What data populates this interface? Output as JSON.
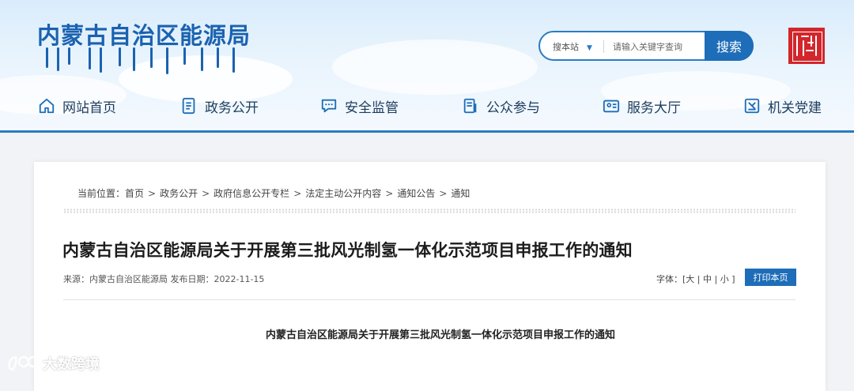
{
  "header": {
    "site_title": "内蒙古自治区能源局",
    "search": {
      "scope_label": "搜本站",
      "placeholder": "请输入关键字查询",
      "button_label": "搜索"
    },
    "seal_glyphs": [
      "内蒙古",
      "ᠥᠪᠥᠷ ᠮᠣᠩᠭᠣᠯ"
    ]
  },
  "nav": {
    "items": [
      {
        "label": "网站首页",
        "icon": "home-icon"
      },
      {
        "label": "政务公开",
        "icon": "document-list-icon"
      },
      {
        "label": "安全监管",
        "icon": "chat-bubble-icon"
      },
      {
        "label": "公众参与",
        "icon": "clipboard-icon"
      },
      {
        "label": "服务大厅",
        "icon": "id-card-icon"
      },
      {
        "label": "机关党建",
        "icon": "party-badge-icon"
      }
    ]
  },
  "breadcrumb": {
    "prefix": "当前位置：",
    "separator": ">",
    "items": [
      "首页",
      "政务公开",
      "政府信息公开专栏",
      "法定主动公开内容",
      "通知公告",
      "通知"
    ]
  },
  "article": {
    "title": "内蒙古自治区能源局关于开展第三批风光制氢一体化示范项目申报工作的通知",
    "meta": "来源：内蒙古自治区能源局 发布日期：2022-11-15",
    "font_size_label": "字体：[",
    "font_sizes": [
      "大",
      "中",
      "小"
    ],
    "font_size_close": "]",
    "print_label": "打印本页",
    "body_title": "内蒙古自治区能源局关于开展第三批风光制氢一体化示范项目申报工作的通知"
  },
  "watermark": {
    "text": "大数跨境"
  },
  "colors": {
    "brand_blue": "#1b62b0",
    "button_blue": "#1e6db8",
    "seal_red": "#d2262c"
  }
}
